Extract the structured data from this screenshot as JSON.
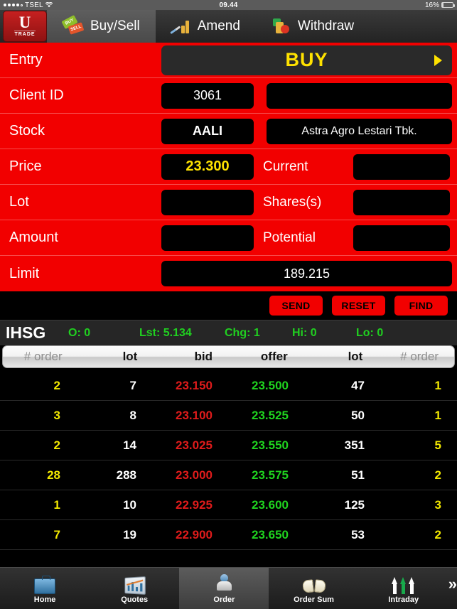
{
  "statusbar": {
    "carrier": "TSEL",
    "signal_dots_filled": 4,
    "signal_dots_total": 5,
    "wifi_icon": "wifi-icon",
    "time": "09.44",
    "battery_percent": "16%",
    "battery_level": 16
  },
  "topnav": {
    "logo": {
      "letter": "U",
      "word": "TRADE"
    },
    "tabs": [
      {
        "label": "Buy/Sell",
        "icon": "buy-sell-tags-icon",
        "active": true
      },
      {
        "label": "Amend",
        "icon": "amend-pen-chart-icon",
        "active": false
      },
      {
        "label": "Withdraw",
        "icon": "withdraw-blocks-icon",
        "active": false
      }
    ]
  },
  "form": {
    "entry": {
      "label": "Entry",
      "value": "BUY",
      "arrow_icon": "chevron-right-icon"
    },
    "client": {
      "label": "Client ID",
      "id": "3061",
      "name": ""
    },
    "stock": {
      "label": "Stock",
      "code": "AALI",
      "name": "Astra Agro Lestari Tbk."
    },
    "price": {
      "label": "Price",
      "value": "23.300",
      "current_label": "Current",
      "current_value": ""
    },
    "lot": {
      "label": "Lot",
      "value": "",
      "shares_label": "Shares(s)",
      "shares_value": ""
    },
    "amount": {
      "label": "Amount",
      "value": "",
      "potential_label": "Potential",
      "potential_value": ""
    },
    "limit": {
      "label": "Limit",
      "value": "189.215"
    }
  },
  "actions": {
    "send": "SEND",
    "reset": "RESET",
    "find": "FIND"
  },
  "index_ticker": {
    "name": "IHSG",
    "open_label": "O:",
    "open_value": "0",
    "last_label": "Lst:",
    "last_value": "5.134",
    "change_label": "Chg:",
    "change_value": "1",
    "high_label": "Hi:",
    "high_value": "0",
    "low_label": "Lo:",
    "low_value": "0",
    "color": "#20d020"
  },
  "orderbook": {
    "headers": [
      "# order",
      "lot",
      "bid",
      "offer",
      "lot",
      "# order"
    ],
    "rows": [
      {
        "buy_order": "2",
        "buy_lot": "7",
        "bid": "23.150",
        "offer": "23.500",
        "sell_lot": "47",
        "sell_order": "1"
      },
      {
        "buy_order": "3",
        "buy_lot": "8",
        "bid": "23.100",
        "offer": "23.525",
        "sell_lot": "50",
        "sell_order": "1"
      },
      {
        "buy_order": "2",
        "buy_lot": "14",
        "bid": "23.025",
        "offer": "23.550",
        "sell_lot": "351",
        "sell_order": "5"
      },
      {
        "buy_order": "28",
        "buy_lot": "288",
        "bid": "23.000",
        "offer": "23.575",
        "sell_lot": "51",
        "sell_order": "2"
      },
      {
        "buy_order": "1",
        "buy_lot": "10",
        "bid": "22.925",
        "offer": "23.600",
        "sell_lot": "125",
        "sell_order": "3"
      },
      {
        "buy_order": "7",
        "buy_lot": "19",
        "bid": "22.900",
        "offer": "23.650",
        "sell_lot": "53",
        "sell_order": "2"
      }
    ]
  },
  "tabbar": {
    "items": [
      {
        "label": "Home",
        "icon": "briefcase-icon",
        "selected": false
      },
      {
        "label": "Quotes",
        "icon": "chart-frame-icon",
        "selected": false
      },
      {
        "label": "Order",
        "icon": "person-book-icon",
        "selected": true
      },
      {
        "label": "Order Sum",
        "icon": "open-book-icon",
        "selected": false
      },
      {
        "label": "Intraday",
        "icon": "up-arrows-icon",
        "selected": false
      }
    ],
    "more_icon": "double-chevron-right-icon",
    "more_label": "»"
  },
  "colors": {
    "panel_red": "#f20000",
    "accent_yellow": "#ffe200",
    "bid_red": "#e01b1b",
    "offer_green": "#1fd41f",
    "order_yellow": "#f2e800"
  }
}
